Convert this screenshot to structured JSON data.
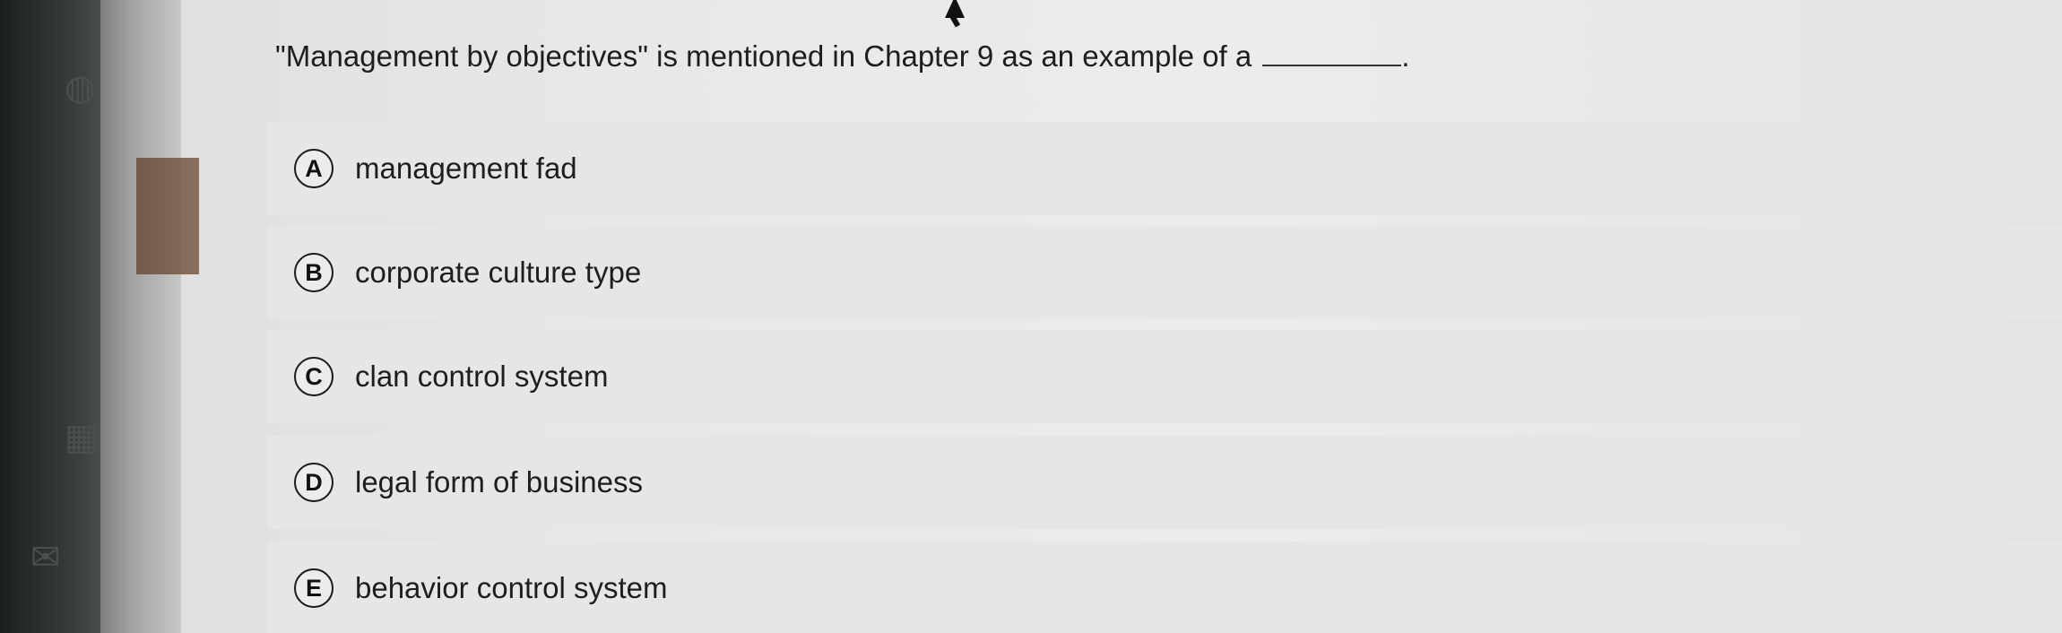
{
  "question": {
    "text": "\"Management by objectives\" is mentioned in Chapter 9 as an example of a",
    "end_punct": "."
  },
  "options": [
    {
      "letter": "A",
      "text": "management fad"
    },
    {
      "letter": "B",
      "text": "corporate culture type"
    },
    {
      "letter": "C",
      "text": "clan control system"
    },
    {
      "letter": "D",
      "text": "legal form of business"
    },
    {
      "letter": "E",
      "text": "behavior control system"
    }
  ],
  "sidebar_icons": [
    "globe-icon",
    "bookmark-icon",
    "calendar-icon",
    "mail-icon"
  ],
  "colors": {
    "background": "#e8e8e6",
    "option_bg": "#e6e6e4",
    "text": "#1e1e1e"
  }
}
